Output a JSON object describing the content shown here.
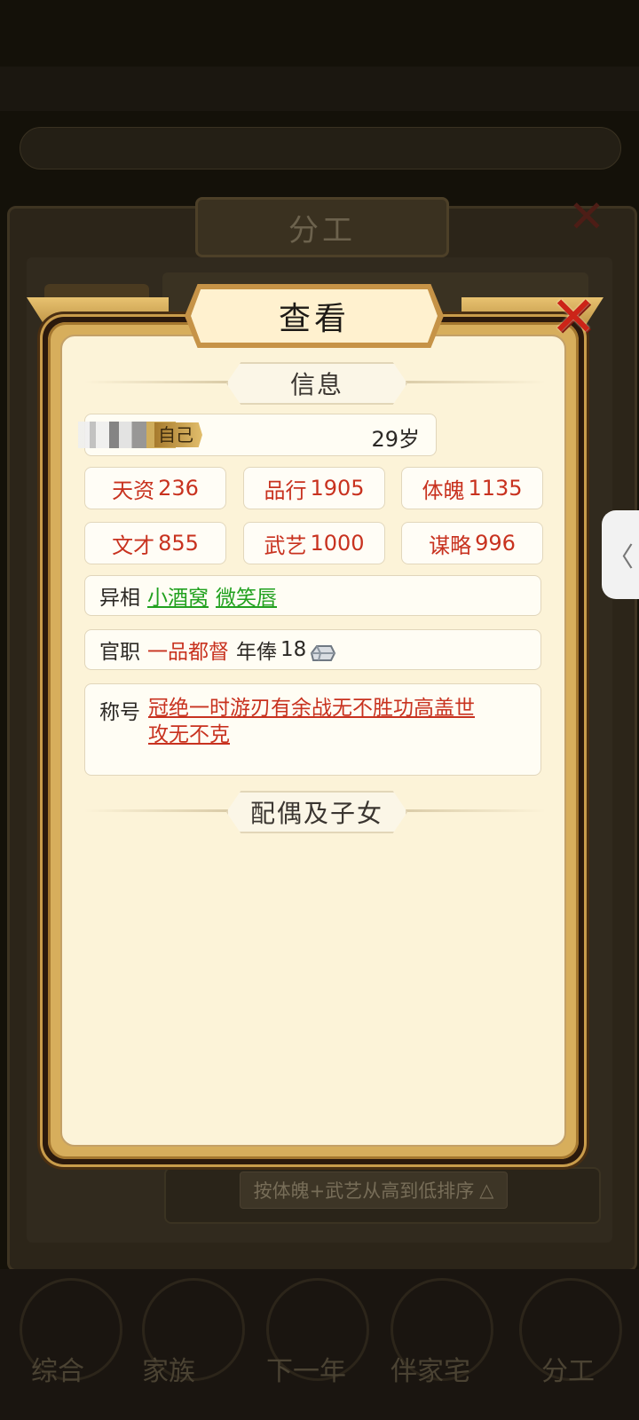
{
  "background": {
    "panel_title": "分工",
    "sort_label": "按体魄+武艺从高到低排序",
    "bottom_tabs": [
      "综合",
      "家族",
      "下一年",
      "伴家宅",
      "分工"
    ]
  },
  "dialog": {
    "title": "查看",
    "info_section": "信息",
    "age": "29岁",
    "name_tag": "自己",
    "stats": [
      {
        "label": "天资",
        "value": "236"
      },
      {
        "label": "品行",
        "value": "1905"
      },
      {
        "label": "体魄",
        "value": "1135"
      },
      {
        "label": "文才",
        "value": "855"
      },
      {
        "label": "武艺",
        "value": "1000"
      },
      {
        "label": "谋略",
        "value": "996"
      }
    ],
    "traits": {
      "label": "异相",
      "items": [
        "小酒窝",
        "微笑唇"
      ]
    },
    "office": {
      "label": "官职",
      "rank": "一品都督",
      "salary_label": "年俸",
      "salary_value": "18"
    },
    "titles": {
      "label": "称号",
      "items": [
        "冠绝一时",
        "游刃有余",
        "战无不胜",
        "功高盖世",
        "攻无不克"
      ]
    },
    "family_section": "配偶及子女"
  },
  "colors": {
    "stat_red": "#c8321f",
    "trait_green": "#22a11f",
    "gold_frame": "#d7ae5c",
    "parchment": "#fcf3d8"
  }
}
